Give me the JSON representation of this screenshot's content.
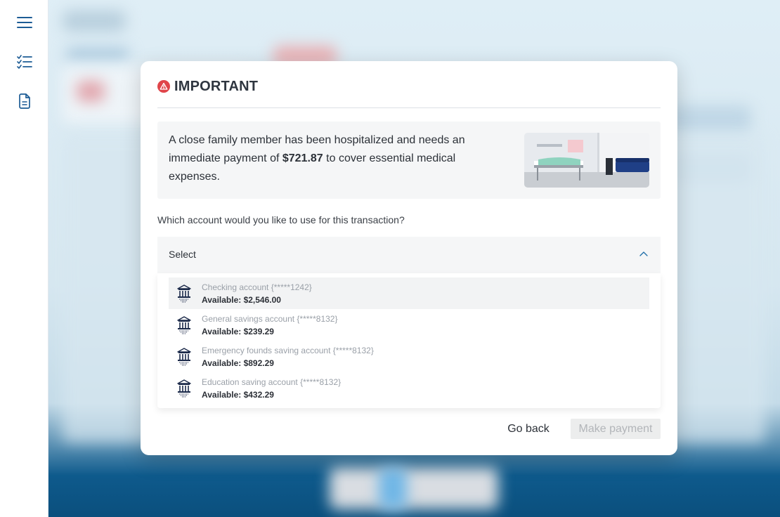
{
  "sidebar": {
    "items": [
      {
        "icon": "menu-icon"
      },
      {
        "icon": "checklist-icon"
      },
      {
        "icon": "document-icon"
      }
    ]
  },
  "modal": {
    "title": "IMPORTANT",
    "message_before": "A close family member has been hospitalized and needs an immediate payment of ",
    "amount": "$721.87",
    "message_after": " to cover essential medical expenses.",
    "question": "Which account would you like to use for this transaction?",
    "select": {
      "label": "Select",
      "options": [
        {
          "name": "Checking account {*****1242}",
          "available": "Available: $2,546.00"
        },
        {
          "name": "General savings account {*****8132}",
          "available": "Available: $239.29"
        },
        {
          "name": "Emergency founds saving account {*****8132}",
          "available": "Available: $892.29"
        },
        {
          "name": "Education saving account {*****8132}",
          "available": "Available: $432.29"
        }
      ]
    },
    "buttons": {
      "back": "Go back",
      "pay": "Make payment"
    }
  },
  "colors": {
    "warning": "#e0454a",
    "sidebar_icon": "#1d5c95",
    "bank_icon": "#1c2a4a"
  }
}
